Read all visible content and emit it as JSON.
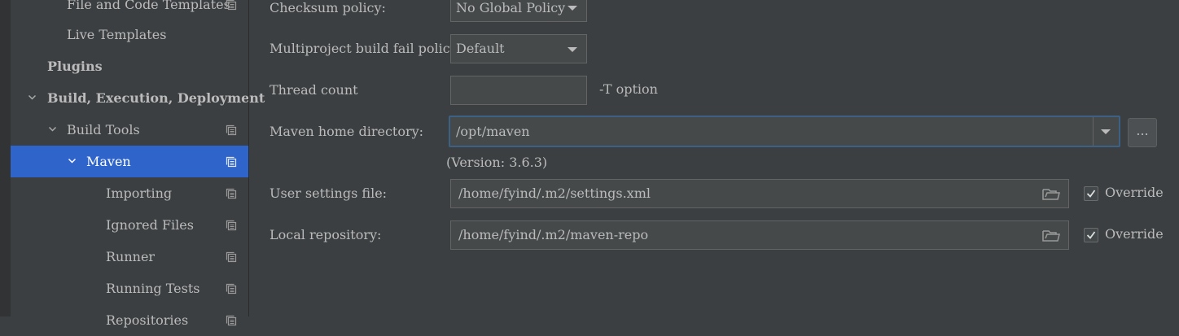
{
  "sidebar": {
    "items": [
      {
        "label": "File and Code Templates"
      },
      {
        "label": "Live Templates"
      },
      {
        "label": "Plugins"
      },
      {
        "label": "Build, Execution, Deployment"
      },
      {
        "label": "Build Tools"
      },
      {
        "label": "Maven"
      },
      {
        "label": "Importing"
      },
      {
        "label": "Ignored Files"
      },
      {
        "label": "Runner"
      },
      {
        "label": "Running Tests"
      },
      {
        "label": "Repositories"
      }
    ]
  },
  "settings": {
    "checksum_policy": {
      "label": "Checksum policy:",
      "value": "No Global Policy"
    },
    "multiproject_fail_policy": {
      "label": "Multiproject build fail policy:",
      "value": "Default"
    },
    "thread_count": {
      "label": "Thread count",
      "value": "",
      "hint": "-T option"
    },
    "maven_home": {
      "label": "Maven home directory:",
      "value": "/opt/maven",
      "version": "(Version: 3.6.3)",
      "browse_label": "..."
    },
    "user_settings": {
      "label": "User settings file:",
      "value": "/home/fyind/.m2/settings.xml",
      "override_label": "Override",
      "override_checked": true
    },
    "local_repository": {
      "label": "Local repository:",
      "value": "/home/fyind/.m2/maven-repo",
      "override_label": "Override",
      "override_checked": true
    }
  },
  "colors": {
    "background": "#3c3f41",
    "selection": "#2f65ca",
    "field": "#45494a",
    "focus": "#3d6185",
    "text": "#bbbbbb"
  }
}
